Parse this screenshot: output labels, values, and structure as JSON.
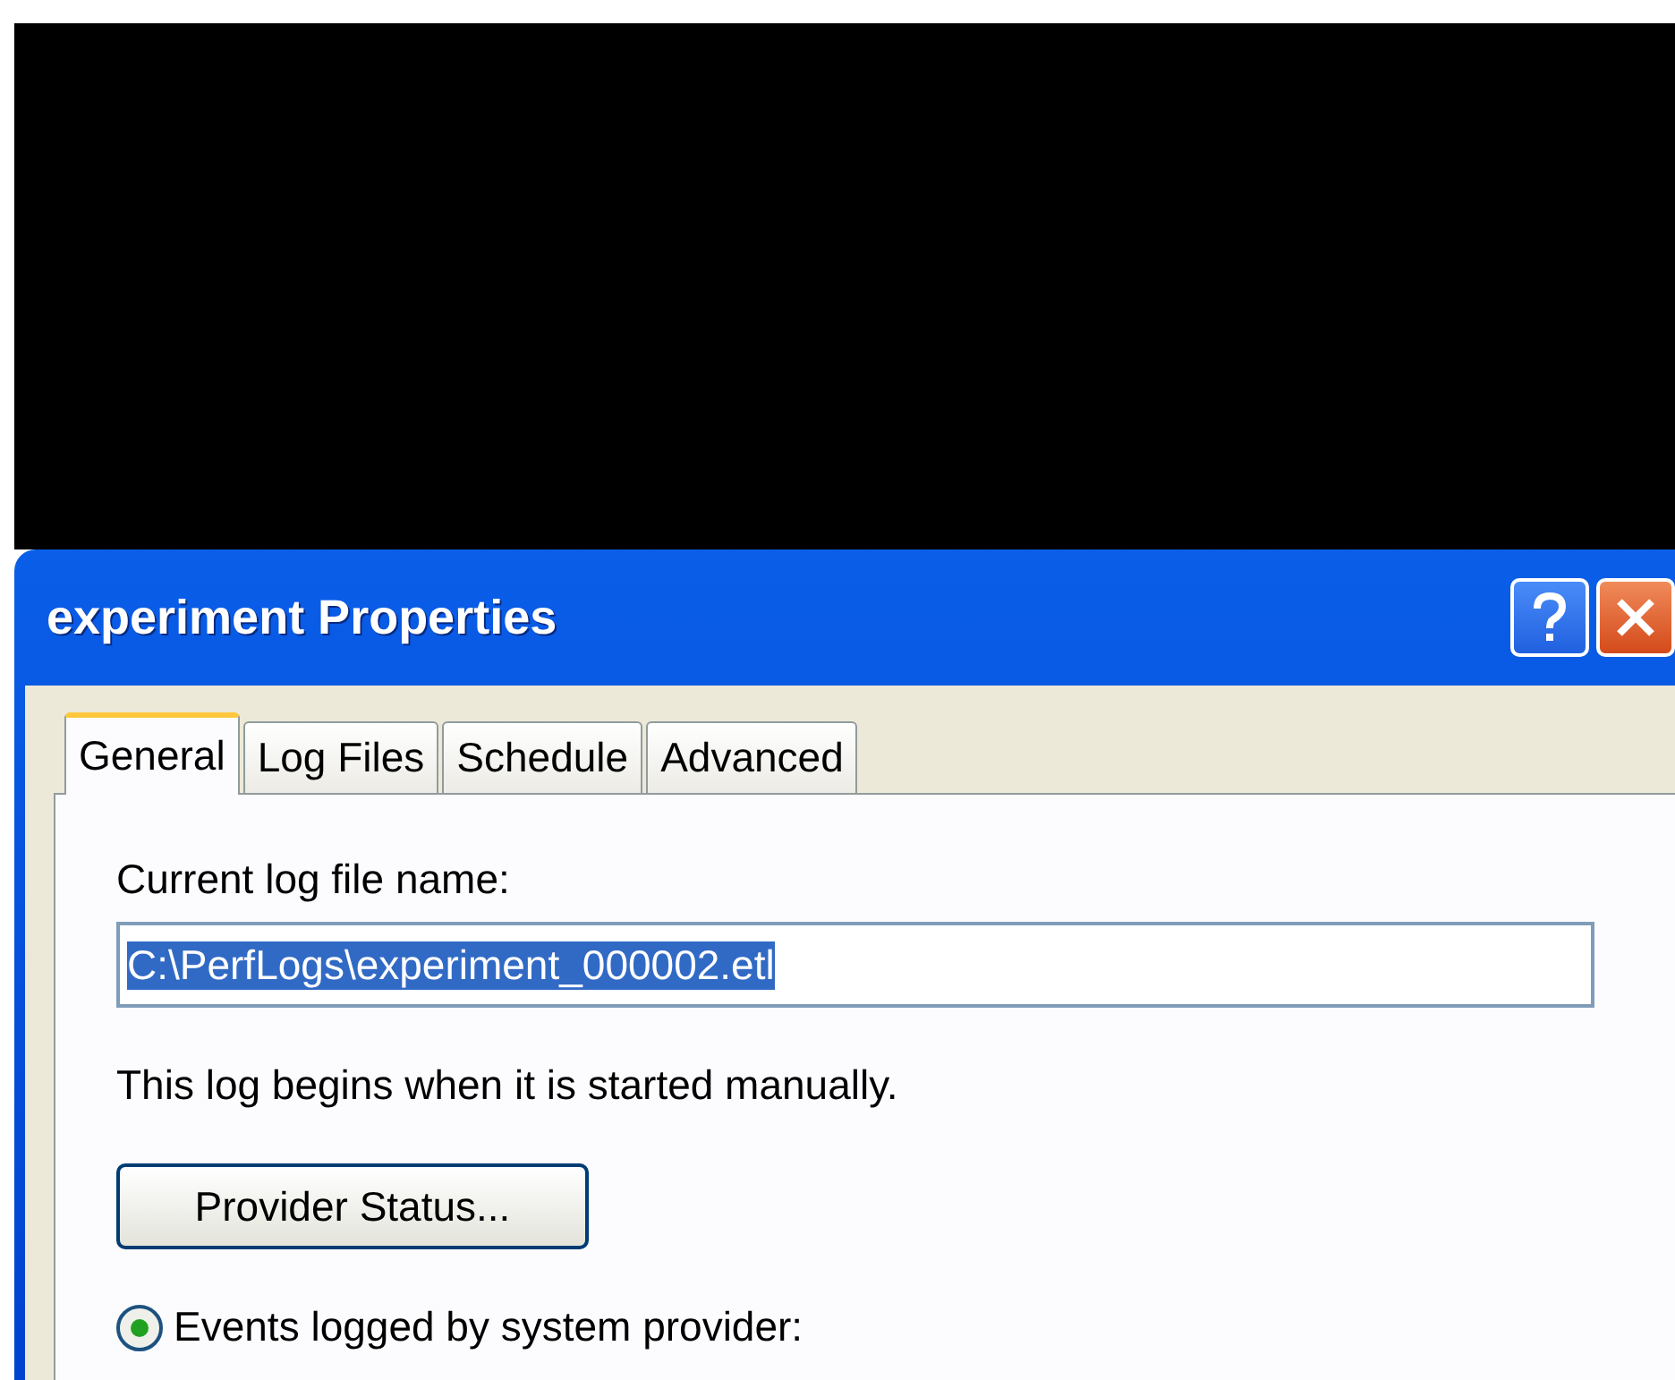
{
  "window": {
    "title": "experiment Properties"
  },
  "tabs": [
    {
      "label": "General",
      "selected": true
    },
    {
      "label": "Log Files",
      "selected": false
    },
    {
      "label": "Schedule",
      "selected": false
    },
    {
      "label": "Advanced",
      "selected": false
    }
  ],
  "log_file": {
    "label": "Current log file name:",
    "value": "C:\\PerfLogs\\experiment_000002.etl"
  },
  "start_note": "This log begins when it is started manually.",
  "provider_button": "Provider Status...",
  "options": [
    {
      "label": "Events logged by system provider:",
      "selected": true
    }
  ]
}
